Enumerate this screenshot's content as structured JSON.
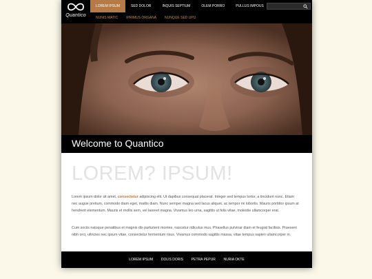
{
  "brand": {
    "name": "Quantico"
  },
  "nav": {
    "items": [
      "LOREM IPSUM",
      "SED DOLOR",
      "INQUIS SEPTIUM",
      "OLEM PORRO",
      "PULLUS IMPOUS"
    ],
    "active_index": 0
  },
  "subnav": {
    "items": [
      "NUNIS MATIC",
      "IPRIMUS ORGANA",
      "NUNQUE SED UPU"
    ]
  },
  "search": {
    "placeholder": ""
  },
  "hero": {
    "title": "Welcome to Quantico"
  },
  "main": {
    "headline": "LOREM? IPSUM!",
    "p1_before": "Lorem ipsum dolor sit amet, ",
    "p1_bold": "consectetur",
    "p1_after": " adipiscing elit. Ut dapibus consequat placerat. Integer sed tempus tortor, a tincidunt nunc. Etiam nec augue pretium, commodo diam eget, mattis diam. Nunc semper magna sed lacus aliquet, ac tempor mi lobortis. Mauris porttitor ipsum at hendrerit elementum. Mauris et mollis sem, vel laoreet magna. Vivamus leo urna, sagittis ut felis vitae, molestie ullamcorper erat.",
    "p2": "Cum sociis natoque penatibus et magnis dis parturient montes, nascetur ridiculus mus. Phasellus pulvinar diam et feugiat facilisis. Praesent nibh orci, ultricies nec ipsum vitae, consectetur fermentum risus. Vivamus commodo sagittis massa, vitae tempus sapien ullamcorper in."
  },
  "footer": {
    "links": [
      "LOREM IPSUM",
      "DOLIS DORIS",
      "PETRA PEPUR",
      "NURIA OKTE"
    ]
  },
  "colors": {
    "accent": "#b57a45",
    "subnav": "#c8904a",
    "background": "#fbf8ea"
  }
}
